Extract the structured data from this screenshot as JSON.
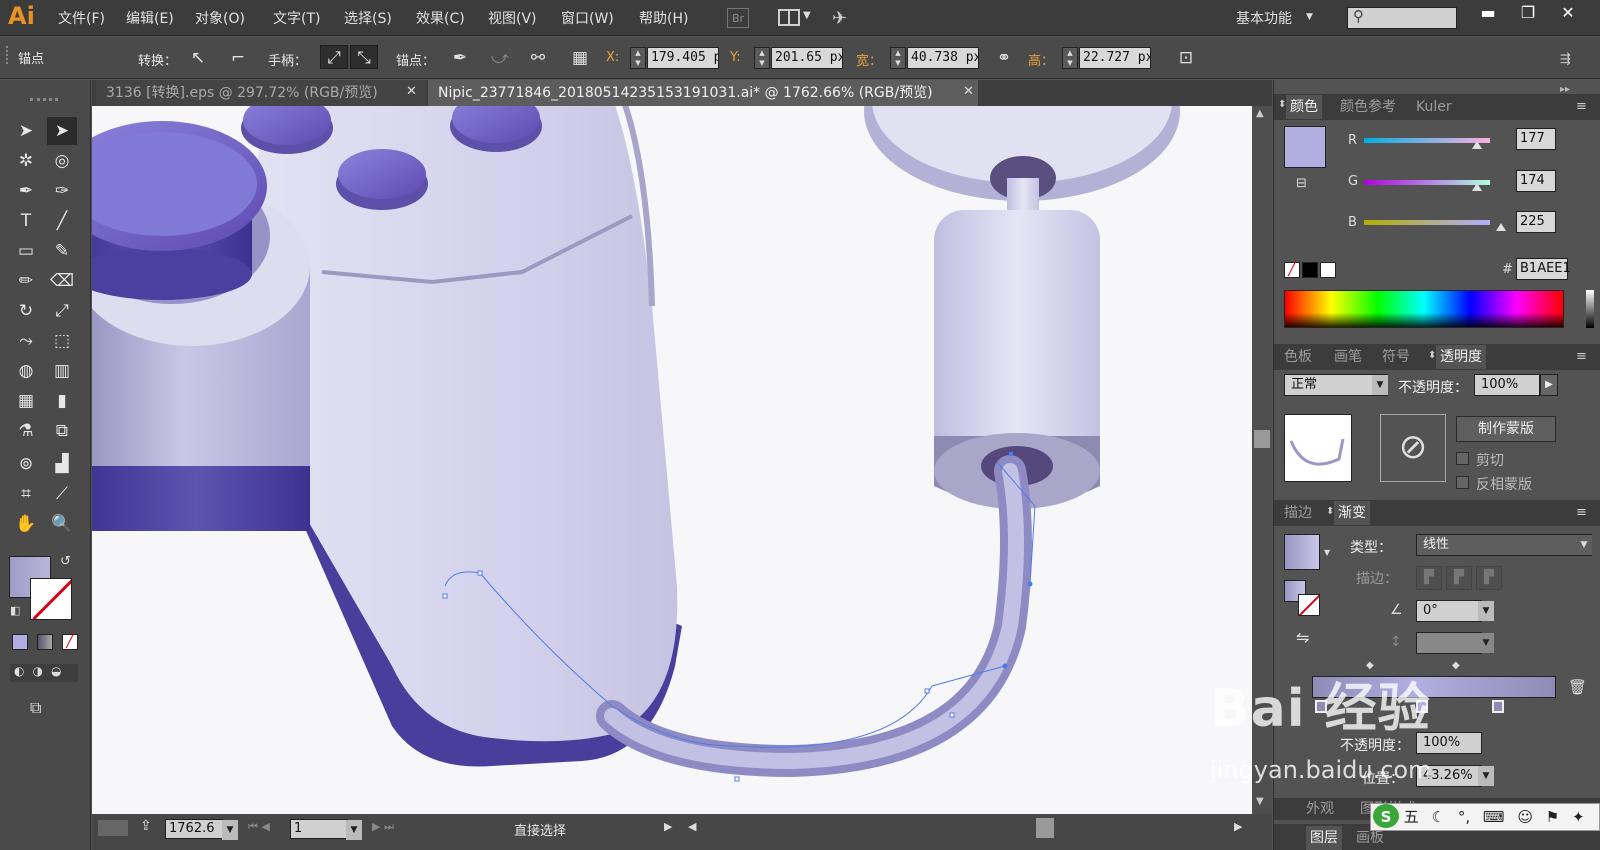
{
  "app": {
    "logo": "Ai",
    "workspace": "基本功能",
    "bridge_label": "Br"
  },
  "menu": [
    "文件(F)",
    "编辑(E)",
    "对象(O)",
    "文字(T)",
    "选择(S)",
    "效果(C)",
    "视图(V)",
    "窗口(W)",
    "帮助(H)"
  ],
  "control": {
    "selection_type": "锚点",
    "convert_label": "转换：",
    "handles_label": "手柄：",
    "anchor_label": "锚点：",
    "x_label": "X:",
    "x_value": "179.405 p",
    "y_label": "Y:",
    "y_value": "201.65 px",
    "w_label": "宽：",
    "w_value": "40.738 px",
    "h_label": "高：",
    "h_value": "22.727 px"
  },
  "tabs": [
    {
      "label": "3136 [转换].eps @ 297.72% (RGB/预览)",
      "active": false
    },
    {
      "label": "Nipic_23771846_20180514235153191031.ai* @ 1762.66% (RGB/预览)",
      "active": true
    }
  ],
  "status": {
    "zoom": "1762.6",
    "artboard": "1",
    "tool": "直接选择"
  },
  "color_panel": {
    "tabs": [
      "颜色",
      "颜色参考",
      "Kuler"
    ],
    "r_label": "R",
    "r": "177",
    "g_label": "G",
    "g": "174",
    "b_label": "B",
    "b": "225",
    "hex_label": "#",
    "hex": "B1AEE1",
    "swatch_color": "#b1aee1"
  },
  "transparency_panel": {
    "tabs": [
      "色板",
      "画笔",
      "符号",
      "透明度"
    ],
    "blend_mode": "正常",
    "opacity_label": "不透明度：",
    "opacity": "100%",
    "make_mask": "制作蒙版",
    "clip": "剪切",
    "invert_mask": "反相蒙版"
  },
  "gradient_panel": {
    "tabs": [
      "描边",
      "渐变"
    ],
    "type_label": "类型：",
    "type": "线性",
    "stroke_label": "描边：",
    "angle": "0°",
    "opacity_label": "不透明度：",
    "opacity_value": "100%",
    "position_label": "位置：",
    "position": "43.26%"
  },
  "bottom_panels": [
    "外观",
    "图形样式"
  ],
  "bottom_panels2": [
    "图层",
    "画板"
  ],
  "watermark": {
    "logo": "Bai 经验",
    "url": "jingyan.baidu.com"
  },
  "ime": {
    "label": "五"
  }
}
